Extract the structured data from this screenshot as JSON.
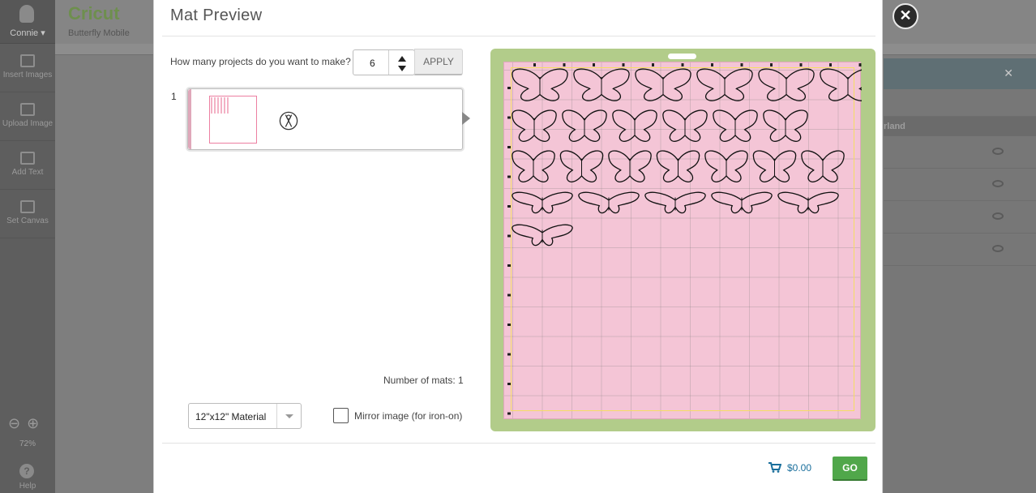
{
  "app": {
    "user_name": "Connie",
    "brand": "Cricut",
    "project_name": "Butterfly Mobile",
    "zoom": "72%",
    "help_label": "Help",
    "tools": [
      {
        "label": "Insert Images"
      },
      {
        "label": "Upload Image"
      },
      {
        "label": "Add Text"
      },
      {
        "label": "Set Canvas"
      }
    ],
    "layers_group_label": "rland"
  },
  "modal": {
    "title": "Mat Preview",
    "projects_question": "How many projects do you want to make?",
    "projects_value": "6",
    "apply_label": "APPLY",
    "mat_index": "1",
    "mats_count_label": "Number of mats:",
    "mats_count_value": "1",
    "material_select": "12\"x12\" Material",
    "mirror_label": "Mirror image (for iron-on)",
    "mirror_checked": false,
    "price": "$0.00",
    "go_label": "GO"
  },
  "colors": {
    "mat_border": "#b2cc8a",
    "mat_surface": "#f4c5d6",
    "cut_area": "#f5dd63",
    "go_button": "#50a74a",
    "price": "#1a6f9c"
  },
  "mat_layout": {
    "butterfly_rows": [
      6,
      6,
      7,
      5,
      1
    ],
    "total_butterflies": 25
  }
}
